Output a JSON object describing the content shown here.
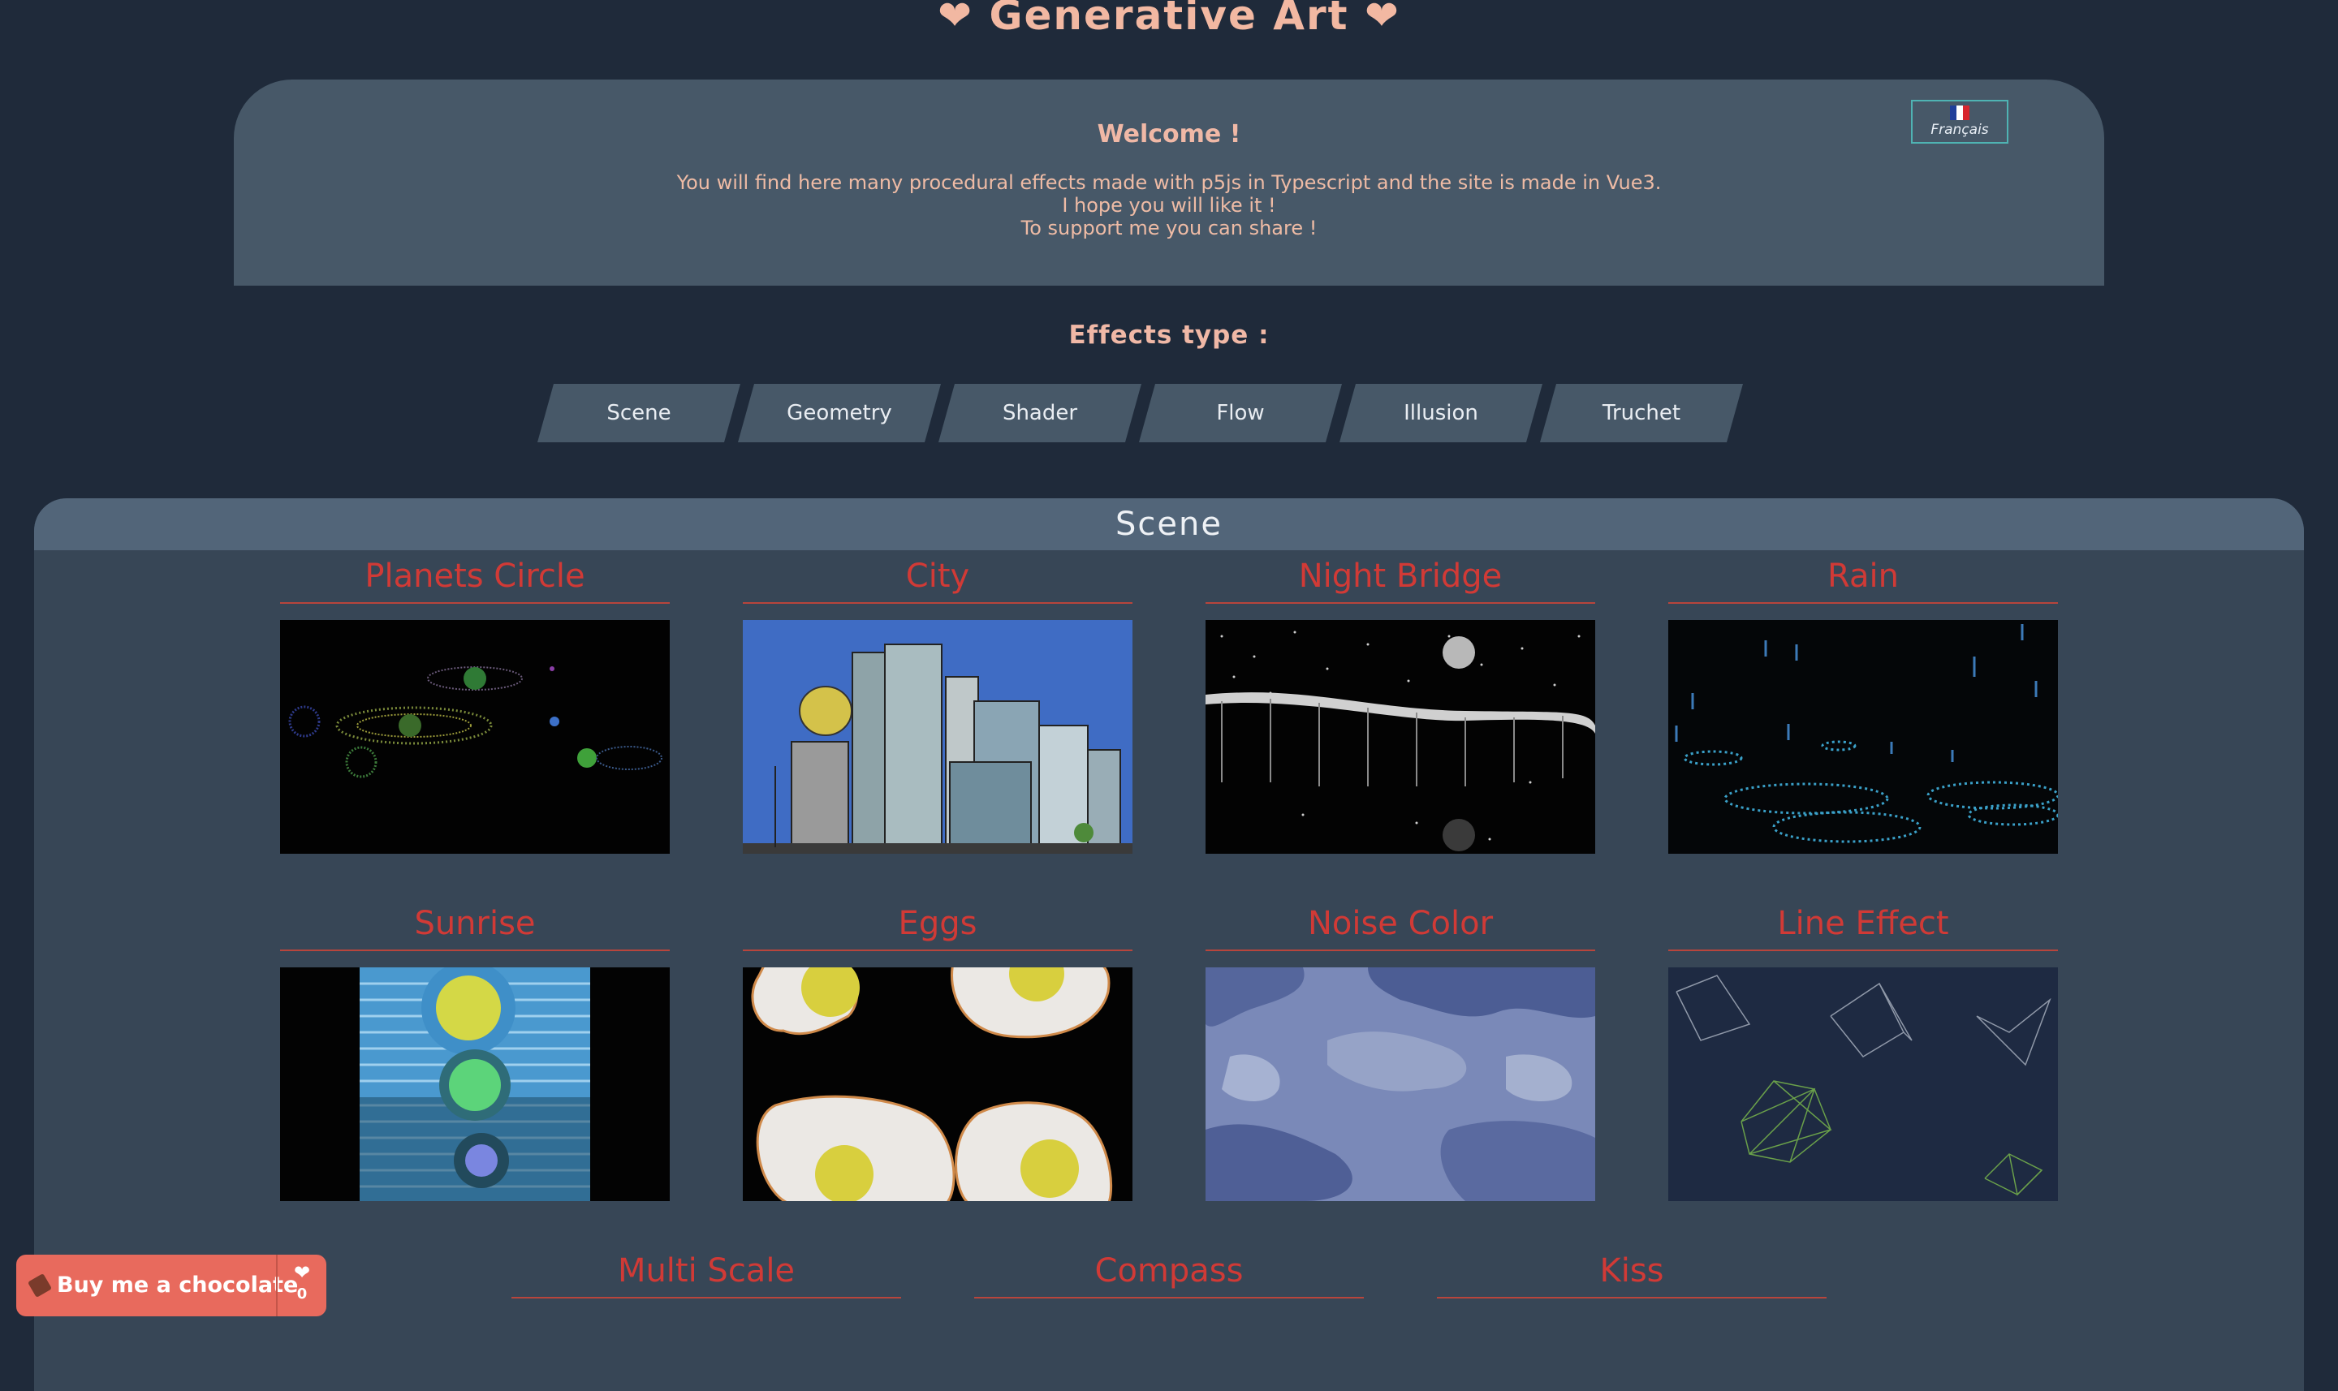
{
  "header": {
    "title": "Generative Art",
    "heart_glyph": "❤"
  },
  "welcome": {
    "heading": "Welcome !",
    "lines": [
      "You will find here many procedural effects made with p5js in Typescript and the site is made in Vue3.",
      "I hope you will like it !",
      "To support me you can share !"
    ]
  },
  "language_button": {
    "label": "Français",
    "flag": "flag-fr-icon"
  },
  "effects": {
    "title": "Effects type :",
    "tabs": [
      "Scene",
      "Geometry",
      "Shader",
      "Flow",
      "Illusion",
      "Truchet"
    ]
  },
  "section": {
    "title": "Scene",
    "cards": [
      {
        "title": "Planets Circle",
        "thumb": "planets-circle-thumbnail"
      },
      {
        "title": "City",
        "thumb": "city-thumbnail"
      },
      {
        "title": "Night Bridge",
        "thumb": "night-bridge-thumbnail"
      },
      {
        "title": "Rain",
        "thumb": "rain-thumbnail"
      },
      {
        "title": "Sunrise",
        "thumb": "sunrise-thumbnail"
      },
      {
        "title": "Eggs",
        "thumb": "eggs-thumbnail"
      },
      {
        "title": "Noise Color",
        "thumb": "noise-color-thumbnail"
      },
      {
        "title": "Line Effect",
        "thumb": "line-effect-thumbnail"
      },
      {
        "title": "Multi Scale",
        "thumb": ""
      },
      {
        "title": "Compass",
        "thumb": ""
      },
      {
        "title": "Kiss",
        "thumb": ""
      }
    ]
  },
  "chocolate_button": {
    "label": "Buy me a chocolate",
    "count": "0",
    "icon": "chocolate-bar-icon"
  },
  "colors": {
    "background": "#1f2a3a",
    "panel": "#475868",
    "accent_text": "#f2b8a2",
    "card_title": "#d13a36",
    "chocolate_button": "#e86a5d"
  }
}
